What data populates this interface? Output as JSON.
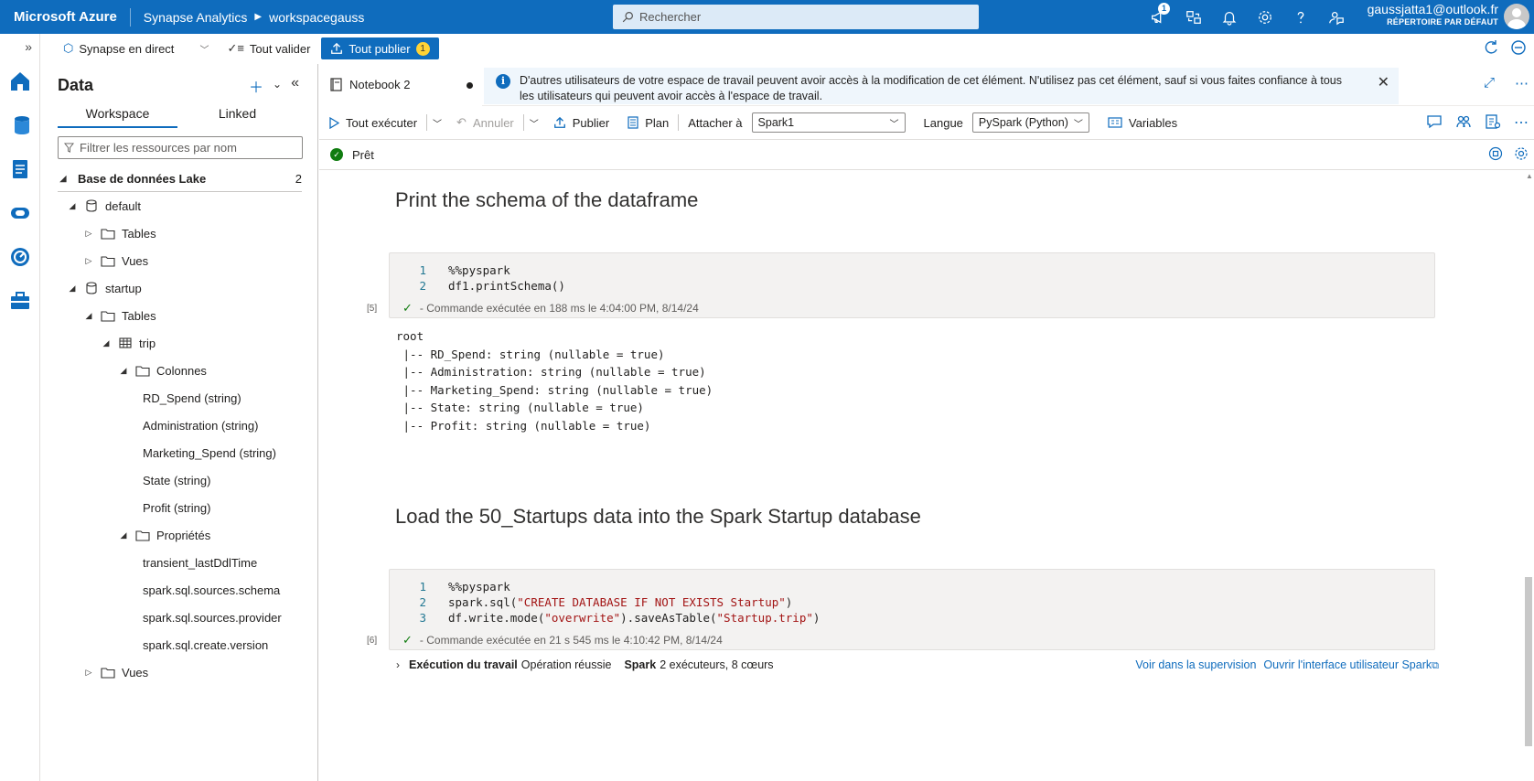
{
  "topbar": {
    "brand": "Microsoft Azure",
    "service": "Synapse Analytics",
    "workspace": "workspacegauss",
    "search_placeholder": "Rechercher",
    "notif_badge": "1",
    "user_email": "gaussjatta1@outlook.fr",
    "user_directory": "RÉPERTOIRE PAR DÉFAUT"
  },
  "cmdbar": {
    "live_mode": "Synapse en direct",
    "validate_all": "Tout valider",
    "publish_all": "Tout publier",
    "publish_count": "1"
  },
  "data_panel": {
    "title": "Data",
    "tabs": [
      "Workspace",
      "Linked"
    ],
    "filter_placeholder": "Filtrer les ressources par nom",
    "section": "Base de données Lake",
    "section_count": "2",
    "tree": [
      {
        "label": "default",
        "level": 1,
        "icon": "database-icon",
        "twisty": "expanded"
      },
      {
        "label": "Tables",
        "level": 2,
        "icon": "folder-icon",
        "twisty": "collapsed"
      },
      {
        "label": "Vues",
        "level": 2,
        "icon": "folder-icon",
        "twisty": "collapsed"
      },
      {
        "label": "startup",
        "level": 1,
        "icon": "database-icon",
        "twisty": "expanded"
      },
      {
        "label": "Tables",
        "level": 2,
        "icon": "folder-icon",
        "twisty": "expanded"
      },
      {
        "label": "trip",
        "level": 3,
        "icon": "table-icon",
        "twisty": "expanded"
      },
      {
        "label": "Colonnes",
        "level": 4,
        "icon": "folder-icon",
        "twisty": "expanded"
      },
      {
        "label": "RD_Spend (string)",
        "level": 5,
        "icon": "",
        "twisty": ""
      },
      {
        "label": "Administration (string)",
        "level": 5,
        "icon": "",
        "twisty": ""
      },
      {
        "label": "Marketing_Spend (string)",
        "level": 5,
        "icon": "",
        "twisty": ""
      },
      {
        "label": "State (string)",
        "level": 5,
        "icon": "",
        "twisty": ""
      },
      {
        "label": "Profit (string)",
        "level": 5,
        "icon": "",
        "twisty": ""
      },
      {
        "label": "Propriétés",
        "level": 4,
        "icon": "folder-icon",
        "twisty": "expanded"
      },
      {
        "label": "transient_lastDdlTime",
        "level": 5,
        "icon": "",
        "twisty": ""
      },
      {
        "label": "spark.sql.sources.schema",
        "level": 5,
        "icon": "",
        "twisty": ""
      },
      {
        "label": "spark.sql.sources.provider",
        "level": 5,
        "icon": "",
        "twisty": ""
      },
      {
        "label": "spark.sql.create.version",
        "level": 5,
        "icon": "",
        "twisty": ""
      },
      {
        "label": "Vues",
        "level": 2,
        "icon": "folder-icon",
        "twisty": "collapsed"
      }
    ]
  },
  "notebook": {
    "tab_title": "Notebook 2",
    "info_message": "D'autres utilisateurs de votre espace de travail peuvent avoir accès à la modification de cet élément. N'utilisez pas cet élément, sauf si vous faites confiance à tous les utilisateurs qui peuvent avoir accès à l'espace de travail.",
    "toolbar": {
      "run_all": "Tout exécuter",
      "undo": "Annuler",
      "publish": "Publier",
      "plan": "Plan",
      "attach_label": "Attacher à",
      "attach_value": "Spark1",
      "language_label": "Langue",
      "language_value": "PySpark (Python)",
      "variables": "Variables"
    },
    "status": "Prêt",
    "sections": [
      {
        "heading": "Print the schema of the dataframe",
        "exec_count": "[5]",
        "code": [
          [
            {
              "t": "%%pyspark",
              "c": ""
            }
          ],
          [
            {
              "t": "df1.printSchema()",
              "c": ""
            }
          ]
        ],
        "status": "- Commande exécutée en 188 ms le 4:04:00 PM, 8/14/24",
        "output": "root\n |-- RD_Spend: string (nullable = true)\n |-- Administration: string (nullable = true)\n |-- Marketing_Spend: string (nullable = true)\n |-- State: string (nullable = true)\n |-- Profit: string (nullable = true)"
      },
      {
        "heading": "Load the 50_Startups data into the Spark Startup database",
        "exec_count": "[6]",
        "code": [
          [
            {
              "t": "%%pyspark",
              "c": ""
            }
          ],
          [
            {
              "t": "spark.sql(",
              "c": ""
            },
            {
              "t": "\"CREATE DATABASE IF NOT EXISTS Startup\"",
              "c": "str"
            },
            {
              "t": ")",
              "c": ""
            }
          ],
          [
            {
              "t": "df.write.mode(",
              "c": ""
            },
            {
              "t": "\"overwrite\"",
              "c": "str"
            },
            {
              "t": ").saveAsTable(",
              "c": ""
            },
            {
              "t": "\"Startup.trip\"",
              "c": "str"
            },
            {
              "t": ")",
              "c": ""
            }
          ]
        ],
        "status": "- Commande exécutée en 21 s 545 ms le 4:10:42 PM, 8/14/24",
        "job": {
          "label": "Exécution du travail",
          "result": "Opération réussie",
          "spark_label": "Spark",
          "spark_info": "2 exécuteurs, 8 cœurs",
          "link_monitor": "Voir dans la supervision",
          "link_spark_ui": "Ouvrir l'interface utilisateur Spark"
        }
      }
    ]
  }
}
